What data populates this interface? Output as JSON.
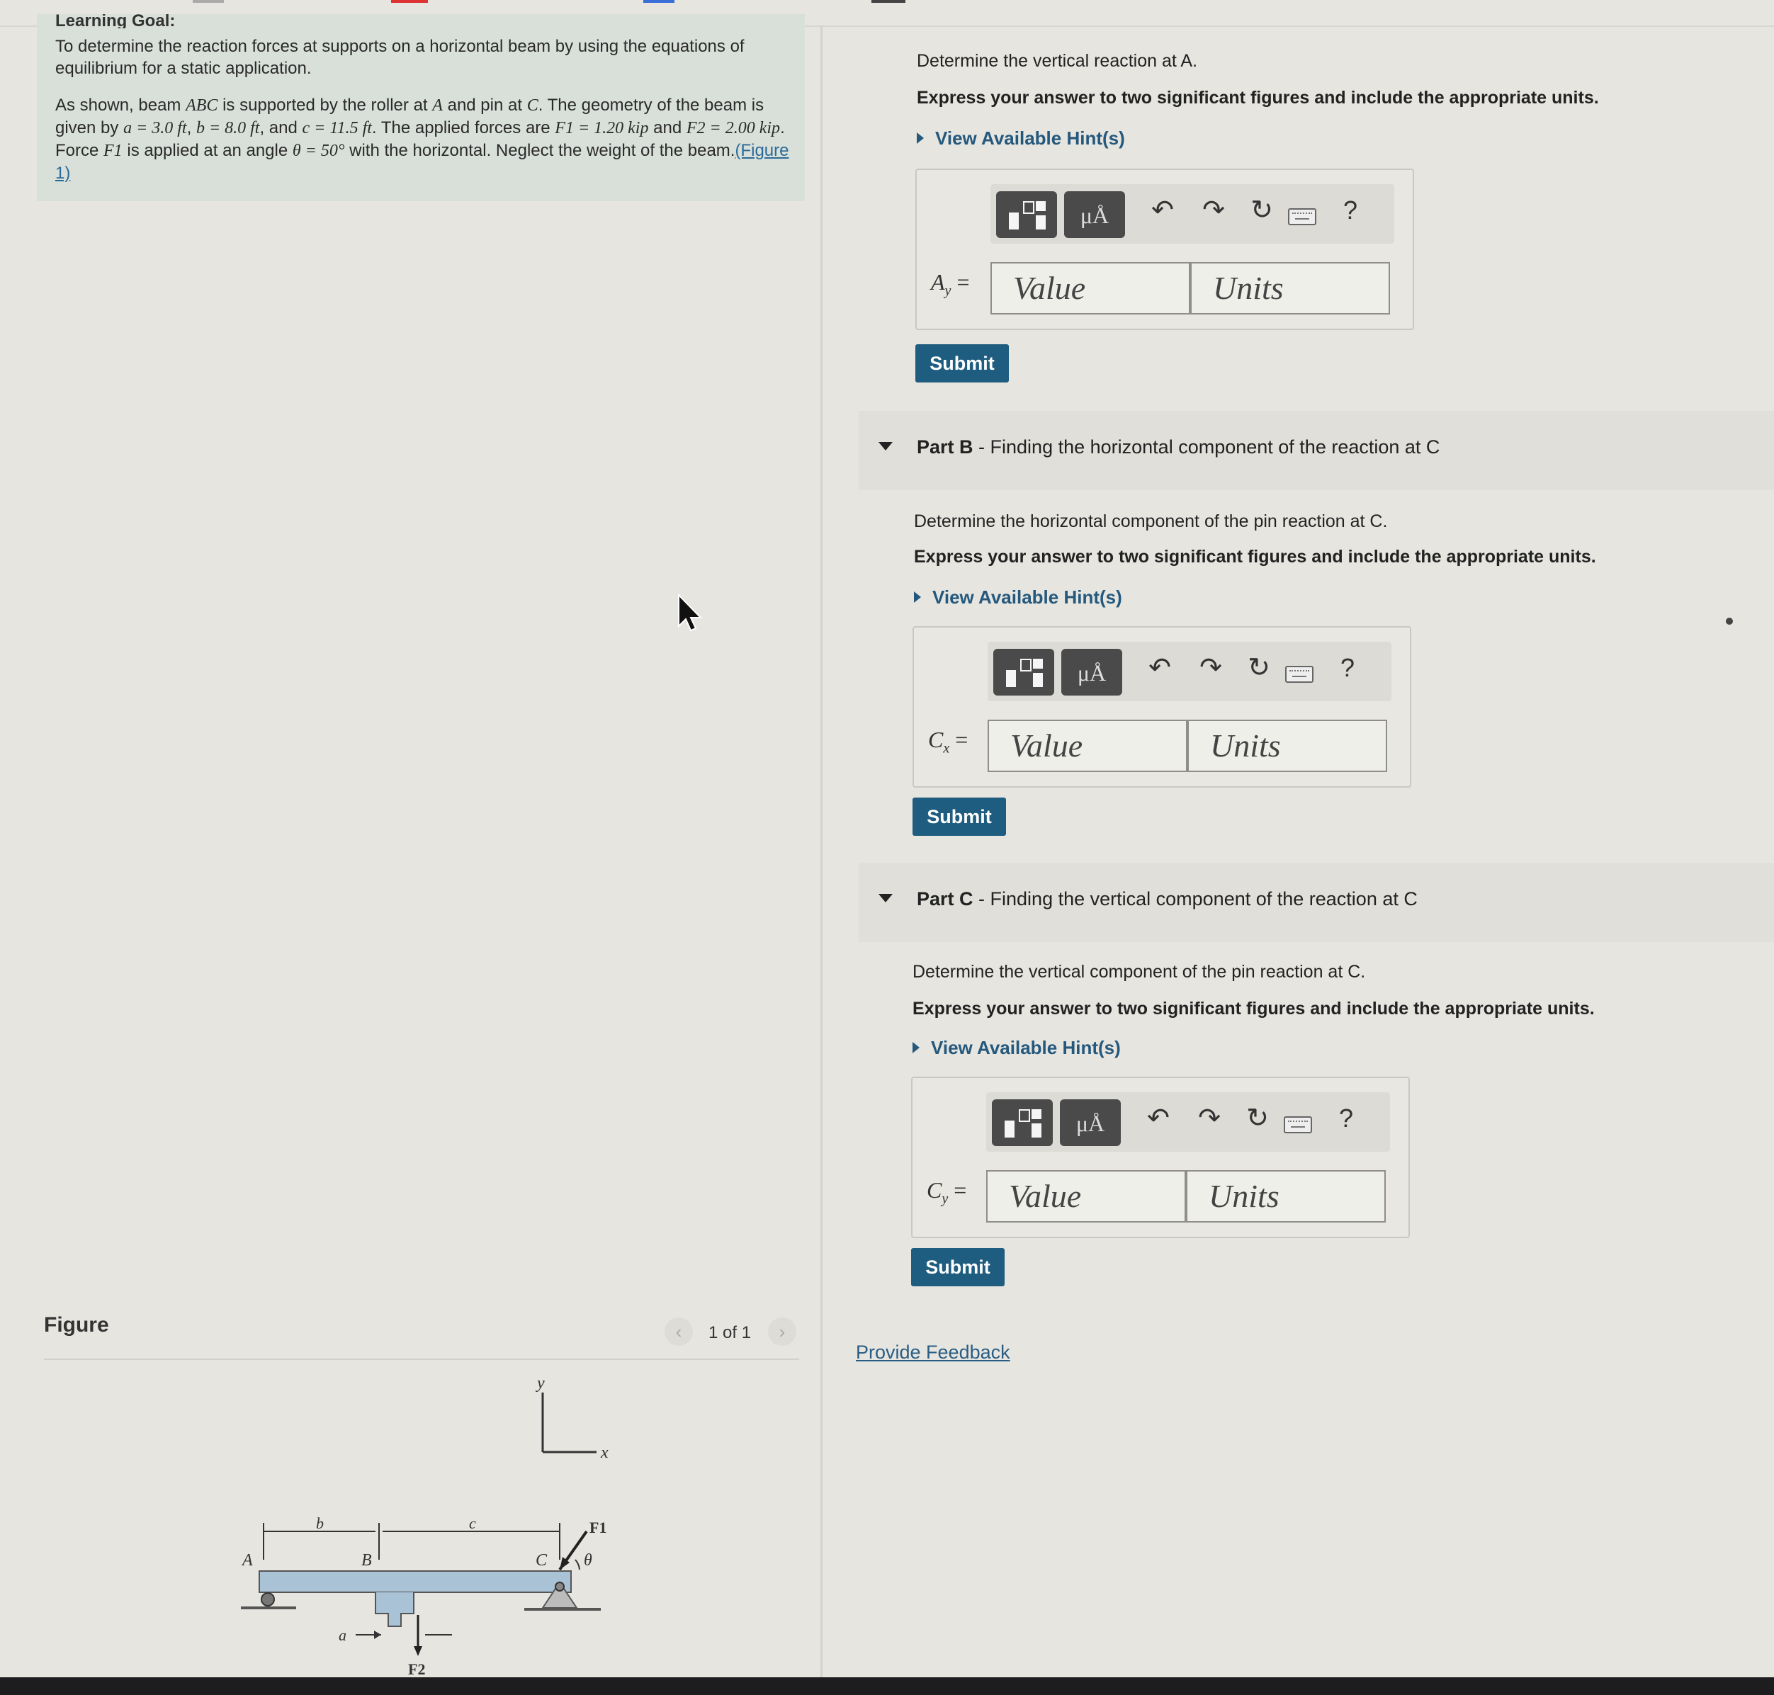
{
  "intro": {
    "heading": "Learning Goal:",
    "goal_text": "To determine the reaction forces at supports on a horizontal beam by using the equations of equilibrium for a static application.",
    "problem": {
      "t1": "As shown, beam ",
      "beam": "ABC",
      "t2": " is supported by the roller at ",
      "a_pt": "A",
      "t3": " and pin at ",
      "c_pt": "C",
      "t4": ". The geometry of the beam is given by ",
      "geom_a": "a = 3.0 ft",
      "t5": ", ",
      "geom_b": "b = 8.0 ft",
      "t6": ", and ",
      "geom_c": "c = 11.5 ft",
      "t7": ". The applied forces are ",
      "f1": "F1 = 1.20 kip",
      "t8": " and ",
      "f2": "F2 = 2.00 kip",
      "t9": ". Force ",
      "f1_name": "F1",
      "t10": " is applied at an angle ",
      "theta": "θ = 50°",
      "t11": " with the horizontal. Neglect the weight of the beam.",
      "figure_link": "(Figure 1)"
    }
  },
  "figure": {
    "title": "Figure",
    "pager": "1 of 1",
    "prev_icon": "chevron-left-icon",
    "next_icon": "chevron-right-icon",
    "labels": {
      "y": "y",
      "x": "x",
      "A": "A",
      "B": "B",
      "C": "C",
      "b": "b",
      "c": "c",
      "a": "a",
      "F1": "F1",
      "F2": "F2",
      "theta": "θ"
    }
  },
  "partA": {
    "question": "Determine the vertical reaction at A.",
    "instruction": "Express your answer to two significant figures and include the appropriate units.",
    "hint": "View Available Hint(s)",
    "variable": "A",
    "subscript": "y",
    "eq": " =",
    "value_placeholder": "Value",
    "units_placeholder": "Units",
    "submit": "Submit"
  },
  "partB": {
    "label": "Part B",
    "title": " - Finding the horizontal component of the reaction at C",
    "question": "Determine the horizontal component of the pin reaction at C.",
    "instruction": "Express your answer to two significant figures and include the appropriate units.",
    "hint": "View Available Hint(s)",
    "variable": "C",
    "subscript": "x",
    "eq": " =",
    "value_placeholder": "Value",
    "units_placeholder": "Units",
    "submit": "Submit"
  },
  "partC": {
    "label": "Part C",
    "title": " - Finding the vertical component of the reaction at C",
    "question": "Determine the vertical component of the pin reaction at C.",
    "instruction": "Express your answer to two significant figures and include the appropriate units.",
    "hint": "View Available Hint(s)",
    "variable": "C",
    "subscript": "y",
    "eq": " =",
    "value_placeholder": "Value",
    "units_placeholder": "Units",
    "submit": "Submit"
  },
  "toolbar": {
    "templates_icon": "templates-icon",
    "units_icon": "units-symbol-icon",
    "units_glyph": "μÅ",
    "undo_glyph": "↶",
    "redo_glyph": "↷",
    "reset_glyph": "↻",
    "keyboard_icon": "keyboard-icon",
    "help_glyph": "?"
  },
  "feedback": "Provide Feedback",
  "colors": {
    "submit": "#1f5d80",
    "link": "#2a6a98",
    "intro_bg": "#d9e0da",
    "page_bg": "#e6e5df",
    "beam": "#a9c2d6"
  }
}
